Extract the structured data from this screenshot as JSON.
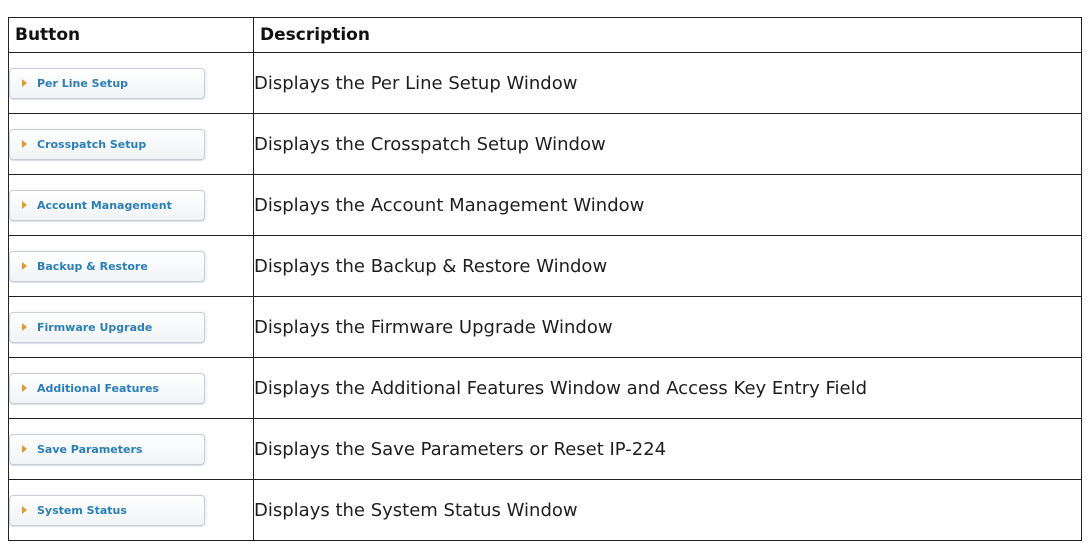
{
  "table": {
    "header": {
      "button": "Button",
      "description": "Description"
    },
    "rows": [
      {
        "button": "Per Line Setup",
        "description": "Displays the Per Line Setup Window"
      },
      {
        "button": "Crosspatch Setup",
        "description": "Displays the Crosspatch Setup Window"
      },
      {
        "button": "Account Management",
        "description": "Displays the Account Management Window"
      },
      {
        "button": "Backup & Restore",
        "description": "Displays the Backup & Restore Window"
      },
      {
        "button": "Firmware Upgrade",
        "description": "Displays the Firmware Upgrade Window"
      },
      {
        "button": "Additional Features",
        "description": "Displays the Additional Features Window and Access Key Entry Field"
      },
      {
        "button": "Save Parameters",
        "description": "Displays the Save Parameters or Reset IP-224"
      },
      {
        "button": "System Status",
        "description": "Displays the System Status Window"
      }
    ]
  },
  "icons": {
    "button_arrow": "caret-right-icon"
  },
  "colors": {
    "button_text": "#2a7fb8",
    "arrow": "#e39a2d",
    "border": "#222222"
  }
}
